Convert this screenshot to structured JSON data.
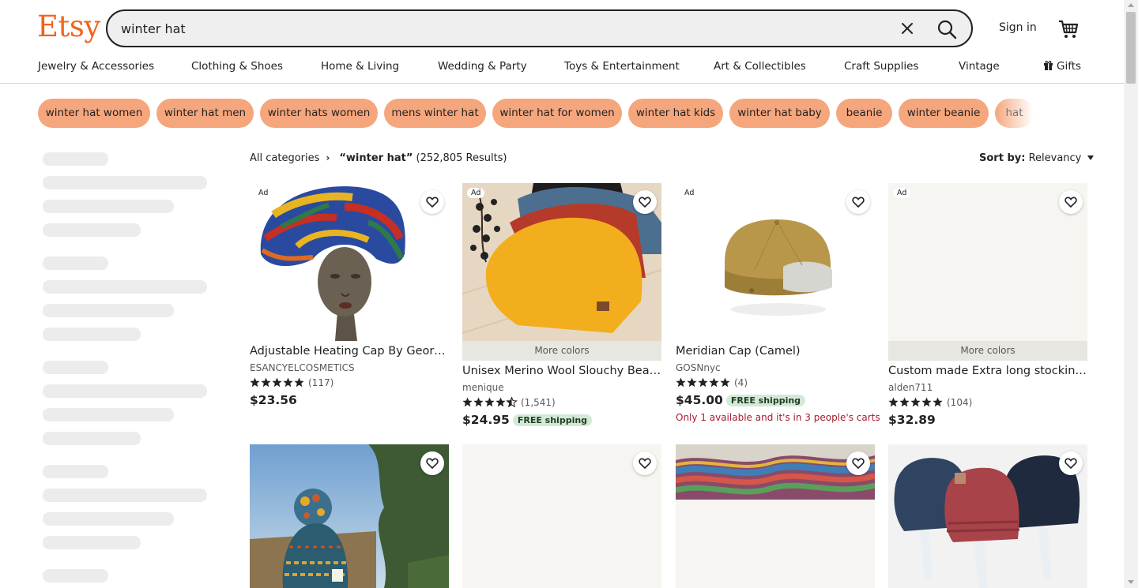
{
  "header": {
    "logo": "Etsy",
    "search_value": "winter hat",
    "signin": "Sign in"
  },
  "nav": [
    {
      "label": "Jewelry & Accessories"
    },
    {
      "label": "Clothing & Shoes"
    },
    {
      "label": "Home & Living"
    },
    {
      "label": "Wedding & Party"
    },
    {
      "label": "Toys & Entertainment"
    },
    {
      "label": "Art & Collectibles"
    },
    {
      "label": "Craft Supplies"
    },
    {
      "label": "Vintage"
    },
    {
      "label": "Gifts",
      "icon": "gift-icon"
    }
  ],
  "chips": [
    "winter hat women",
    "winter hat men",
    "winter hats women",
    "mens winter hat",
    "winter hat for women",
    "winter hat kids",
    "winter hat baby",
    "beanie",
    "winter beanie",
    "hat"
  ],
  "results": {
    "breadcrumb_root": "All categories",
    "query": "“winter hat”",
    "count": "(252,805 Results)",
    "sort_label": "Sort by:",
    "sort_value": "Relevancy"
  },
  "listings": [
    {
      "ad": "Ad",
      "title": "Adjustable Heating Cap By GeorgesCosmetics (Brown)",
      "shop": "ESANCYELCOSMETICS",
      "rating": 5,
      "reviews": "(117)",
      "price": "$23.56",
      "image": "bonnet-photo"
    },
    {
      "ad": "Ad",
      "more_colors": "More colors",
      "title": "Unisex Merino Wool Slouchy Beanie Hat",
      "shop": "menique",
      "rating": 4.5,
      "reviews": "(1,541)",
      "price": "$24.95",
      "free_shipping": "FREE shipping",
      "image": "beanie-stack-photo"
    },
    {
      "ad": "Ad",
      "title": "Meridian Cap (Camel)",
      "shop": "GOSNnyc",
      "rating": 5,
      "reviews": "(4)",
      "price": "$45.00",
      "free_shipping": "FREE shipping",
      "urgency": "Only 1 available and it's in 3 people's carts",
      "image": "docker-cap-photo"
    },
    {
      "ad": "Ad",
      "more_colors": "More colors",
      "title": "Custom made Extra long stocking hat",
      "shop": "alden711",
      "rating": 5,
      "reviews": "(104)",
      "price": "$32.89",
      "image": "blank-photo"
    },
    {
      "image": "pompom-hat-photo"
    },
    {
      "image": "blank-photo"
    },
    {
      "image": "rainbow-knit-photo"
    },
    {
      "image": "three-beanies-photo"
    }
  ],
  "colors": {
    "brand": "#f1641e",
    "chip": "#f5a67c",
    "free_shipping_bg": "#d4e9d7",
    "urgency": "#a61a2e"
  }
}
